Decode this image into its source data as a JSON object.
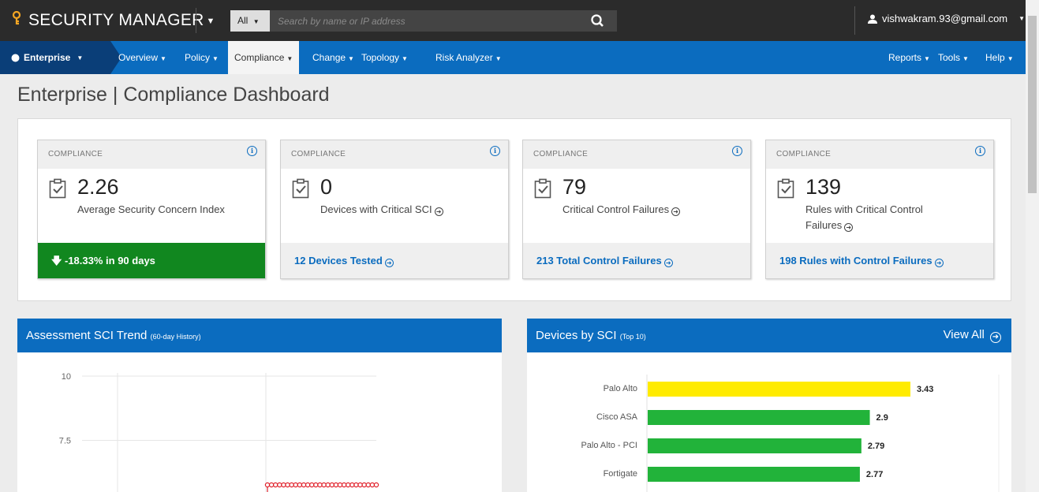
{
  "app": {
    "title": "SECURITY MANAGER"
  },
  "search": {
    "scope": "All",
    "placeholder": "Search by name or IP address"
  },
  "user": {
    "email": "vishwakram.93@gmail.com"
  },
  "nav": {
    "scope": "Enterprise",
    "items": [
      "Overview",
      "Policy",
      "Compliance",
      "Change",
      "Topology",
      "Risk Analyzer"
    ],
    "active": "Compliance",
    "right_items": [
      "Reports",
      "Tools",
      "Help"
    ]
  },
  "page": {
    "title": "Enterprise | Compliance Dashboard"
  },
  "cards": [
    {
      "label": "COMPLIANCE",
      "value": "2.26",
      "description": "Average Security Concern Index",
      "footer": "-18.33% in 90 days",
      "footer_style": "trend"
    },
    {
      "label": "COMPLIANCE",
      "value": "0",
      "description": "Devices with Critical SCI",
      "footer": "12 Devices Tested",
      "footer_style": "link"
    },
    {
      "label": "COMPLIANCE",
      "value": "79",
      "description": "Critical Control Failures",
      "footer": "213 Total Control Failures",
      "footer_style": "link"
    },
    {
      "label": "COMPLIANCE",
      "value": "139",
      "description": "Rules with Critical Control Failures",
      "footer": "198 Rules with Control Failures",
      "footer_style": "link"
    }
  ],
  "trend_widget": {
    "title": "Assessment SCI Trend",
    "subtitle": "(60-day History)"
  },
  "devices_widget": {
    "title": "Devices by SCI",
    "subtitle": "(Top 10)",
    "view_all": "View All"
  },
  "chart_data": [
    {
      "type": "line",
      "title": "Assessment SCI Trend",
      "y_ticks": [
        "10",
        "7.5"
      ],
      "ylim": [
        5,
        10
      ],
      "series": [
        {
          "values": [
            5,
            5,
            5,
            5,
            5,
            5,
            5,
            5,
            5,
            5,
            5,
            5,
            5,
            5,
            5,
            5,
            5,
            5,
            5,
            5,
            5,
            5,
            5,
            5,
            5,
            5,
            5,
            5
          ]
        }
      ],
      "grid": true,
      "color": "#e0202a"
    },
    {
      "type": "bar",
      "orientation": "horizontal",
      "title": "Devices by SCI",
      "categories": [
        "Palo Alto",
        "Cisco ASA",
        "Palo Alto - PCI",
        "Fortigate"
      ],
      "values": [
        3.43,
        2.9,
        2.79,
        2.77
      ],
      "colors": [
        "#ffeb00",
        "#22b33a",
        "#22b33a",
        "#22b33a"
      ],
      "labels": [
        "3.43",
        "2.9",
        "2.79",
        "2.77"
      ]
    }
  ],
  "icons": {
    "brand": "key-icon",
    "search": "search-icon",
    "user": "user-icon",
    "globe": "globe-icon",
    "info": "info-icon",
    "clipboard": "clipboard-check-icon"
  },
  "colors": {
    "topbar": "#2b2b2b",
    "nav": "#0b6cbf",
    "trend_good": "#11871f",
    "accent": "#f5a623"
  }
}
